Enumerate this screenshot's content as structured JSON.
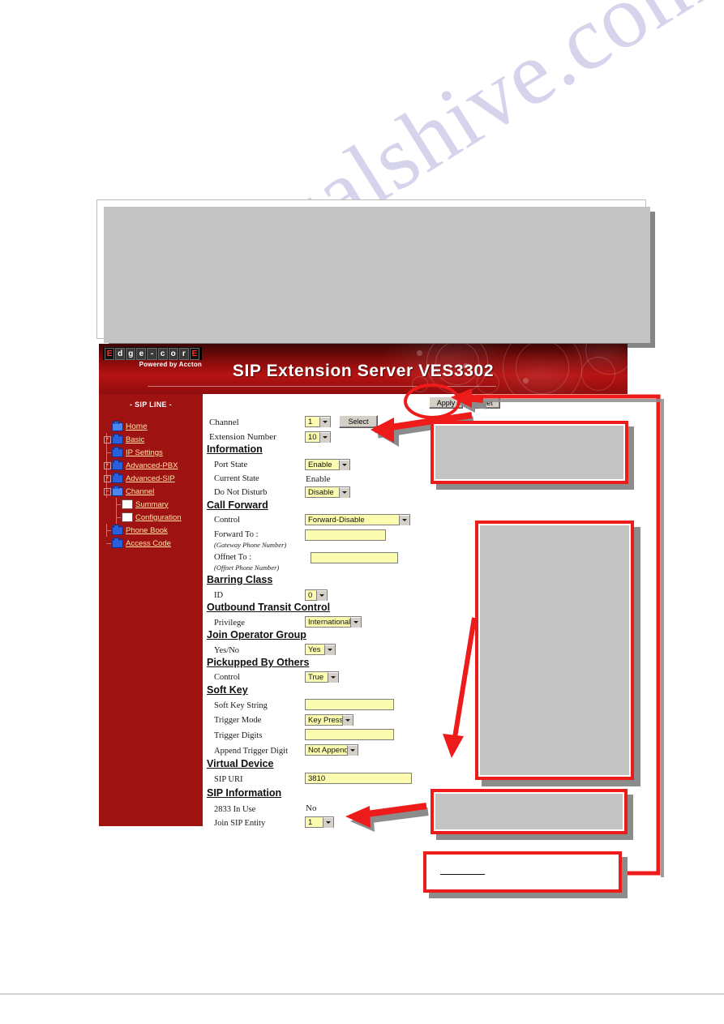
{
  "page": {
    "watermark": "manualshive.com"
  },
  "webui": {
    "logo": {
      "letters": [
        "E",
        "d",
        "g",
        "e",
        "-",
        "c",
        "o",
        "r",
        "E"
      ],
      "tagline": "Powered by Accton"
    },
    "banner_title": "SIP Extension Server VES3302",
    "sidebar": {
      "heading": "- SIP LINE -",
      "items": [
        {
          "label": "Home",
          "icon": "open-folder-icon",
          "expander": "none",
          "indent": 0
        },
        {
          "label": "Basic",
          "icon": "folder-icon",
          "expander": "plus",
          "indent": 0
        },
        {
          "label": "IP Settings",
          "icon": "folder-icon",
          "expander": "tee",
          "indent": 0
        },
        {
          "label": "Advanced-PBX",
          "icon": "folder-icon",
          "expander": "plus",
          "indent": 0
        },
        {
          "label": "Advanced-SIP",
          "icon": "folder-icon",
          "expander": "plus",
          "indent": 0
        },
        {
          "label": "Channel",
          "icon": "open-folder-icon",
          "expander": "minus",
          "indent": 0
        },
        {
          "label": "Summary",
          "icon": "document-icon",
          "expander": "tee",
          "indent": 1
        },
        {
          "label": "Configuration",
          "icon": "document-icon",
          "expander": "tee",
          "indent": 1
        },
        {
          "label": "Phone Book",
          "icon": "folder-icon",
          "expander": "tee",
          "indent": 0
        },
        {
          "label": "Access Code",
          "icon": "folder-icon",
          "expander": "tee",
          "indent": 0
        }
      ]
    },
    "buttons": {
      "apply": "Apply",
      "reset": "Reset"
    },
    "form": {
      "channel_label": "Channel",
      "channel_value": "1",
      "select_button": "Select",
      "extension_label": "Extension Number",
      "extension_value": "10",
      "sections": {
        "information": "Information",
        "call_forward": "Call Forward ",
        "barring_class": "Barring Class",
        "outbound_transit": "Outbound Transit Control",
        "join_operator_group": "Join Operator Group",
        "pickupped": "Pickupped By Others",
        "soft_key": "Soft Key",
        "virtual_device": "Virtual Device",
        "sip_information": "SIP Information"
      },
      "port_state_label": "Port State",
      "port_state_value": "Enable",
      "current_state_label": "Current State",
      "current_state_value": "Enable",
      "dnd_label": "Do Not Disturb",
      "dnd_value": "Disable",
      "cf_control_label": "Control",
      "cf_control_value": "Forward-Disable",
      "forward_to_label": "Forward To :",
      "forward_to_note": "(Gateway Phone Number)",
      "forward_to_value": "",
      "offnet_to_label": "Offnet To :",
      "offnet_to_note": "(Offnet Phone Number)",
      "offnet_to_value": "",
      "barring_id_label": "ID",
      "barring_id_value": "0",
      "privilege_label": "Privilege",
      "privilege_value": "International",
      "yesno_label": "Yes/No",
      "yesno_value": "Yes",
      "pickup_control_label": "Control",
      "pickup_control_value": "True",
      "soft_key_string_label": "Soft Key String",
      "soft_key_string_value": "",
      "trigger_mode_label": "Trigger Mode",
      "trigger_mode_value": "Key Press",
      "trigger_digits_label": "Trigger Digits",
      "trigger_digits_value": "",
      "append_trigger_label": "Append Trigger Digit",
      "append_trigger_value": "Not Append",
      "sip_uri_label": "SIP URI",
      "sip_uri_value": "3810",
      "in_use_label": "2833 In Use",
      "in_use_value": "No",
      "join_sip_label": "Join SIP Entity",
      "join_sip_value": "1"
    }
  },
  "annotations": {
    "accent_red": "#ee1b1b",
    "placeholder_gray": "#c3c3c3",
    "shadow_gray": "#8c8c8c",
    "callouts": [
      {
        "name": "select-button-callout"
      },
      {
        "name": "channel-fields-callout"
      },
      {
        "name": "join-sip-entity-callout"
      },
      {
        "name": "note-callout"
      }
    ]
  }
}
